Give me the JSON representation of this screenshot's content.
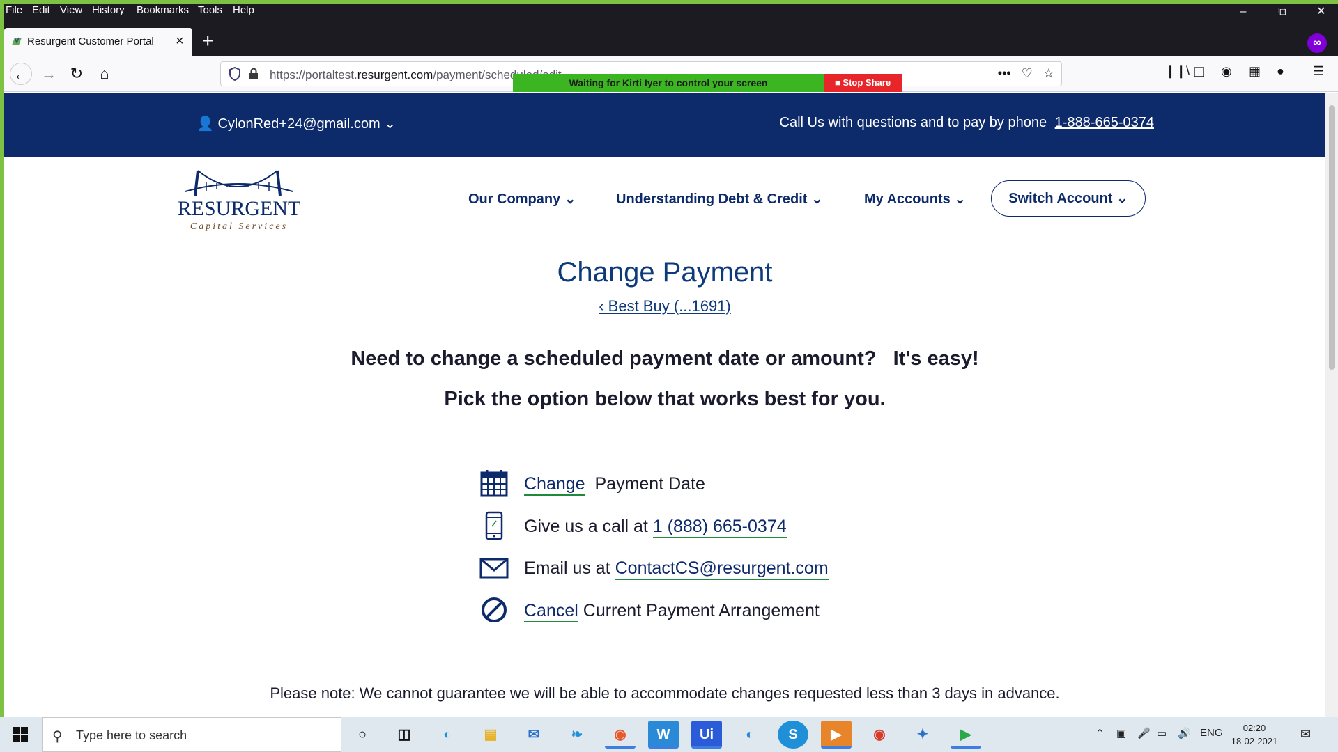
{
  "browser": {
    "menu": [
      "File",
      "Edit",
      "View",
      "History",
      "Bookmarks",
      "Tools",
      "Help"
    ],
    "tab_title": "Resurgent Customer Portal",
    "url_prefix": "https://portaltest.",
    "url_domain": "resurgent.com",
    "url_path": "/payment/scheduled/edit"
  },
  "screen_share": {
    "waiting_text": "Waiting for Kirti Iyer to control your screen",
    "stop_label": "Stop Share"
  },
  "site": {
    "user_email": "CylonRed+24@gmail.com",
    "call_text": "Call Us with questions and to pay by phone",
    "call_number": "1-888-665-0374",
    "logo_name": "RESURGENT",
    "logo_sub": "Capital Services",
    "nav": [
      "Our Company",
      "Understanding Debt & Credit",
      "My Accounts"
    ],
    "switch_account": "Switch Account"
  },
  "main": {
    "heading": "Change Payment",
    "back_link": "‹ Best Buy (...1691)",
    "line1": "Need to change a scheduled payment date or amount?   It's easy!",
    "line2": "Pick the option below that works best for you.",
    "options": {
      "change_link": "Change",
      "change_rest": "Payment Date",
      "call_prefix": "Give us a call at ",
      "call_link": "1 (888) 665-0374",
      "email_prefix": "Email us at ",
      "email_link": "ContactCS@resurgent.com",
      "cancel_link": "Cancel",
      "cancel_rest": " Current Payment Arrangement"
    },
    "note": "Please note: We cannot guarantee we will be able to accommodate changes requested less than 3 days in advance."
  },
  "taskbar": {
    "search_placeholder": "Type here to search",
    "language": "ENG",
    "time": "02:20",
    "date": "18-02-2021"
  },
  "colors": {
    "brand_navy": "#0d2a6b",
    "link_underline": "#1f8a3a",
    "share_green": "#3cb522",
    "share_red": "#e8262a"
  }
}
